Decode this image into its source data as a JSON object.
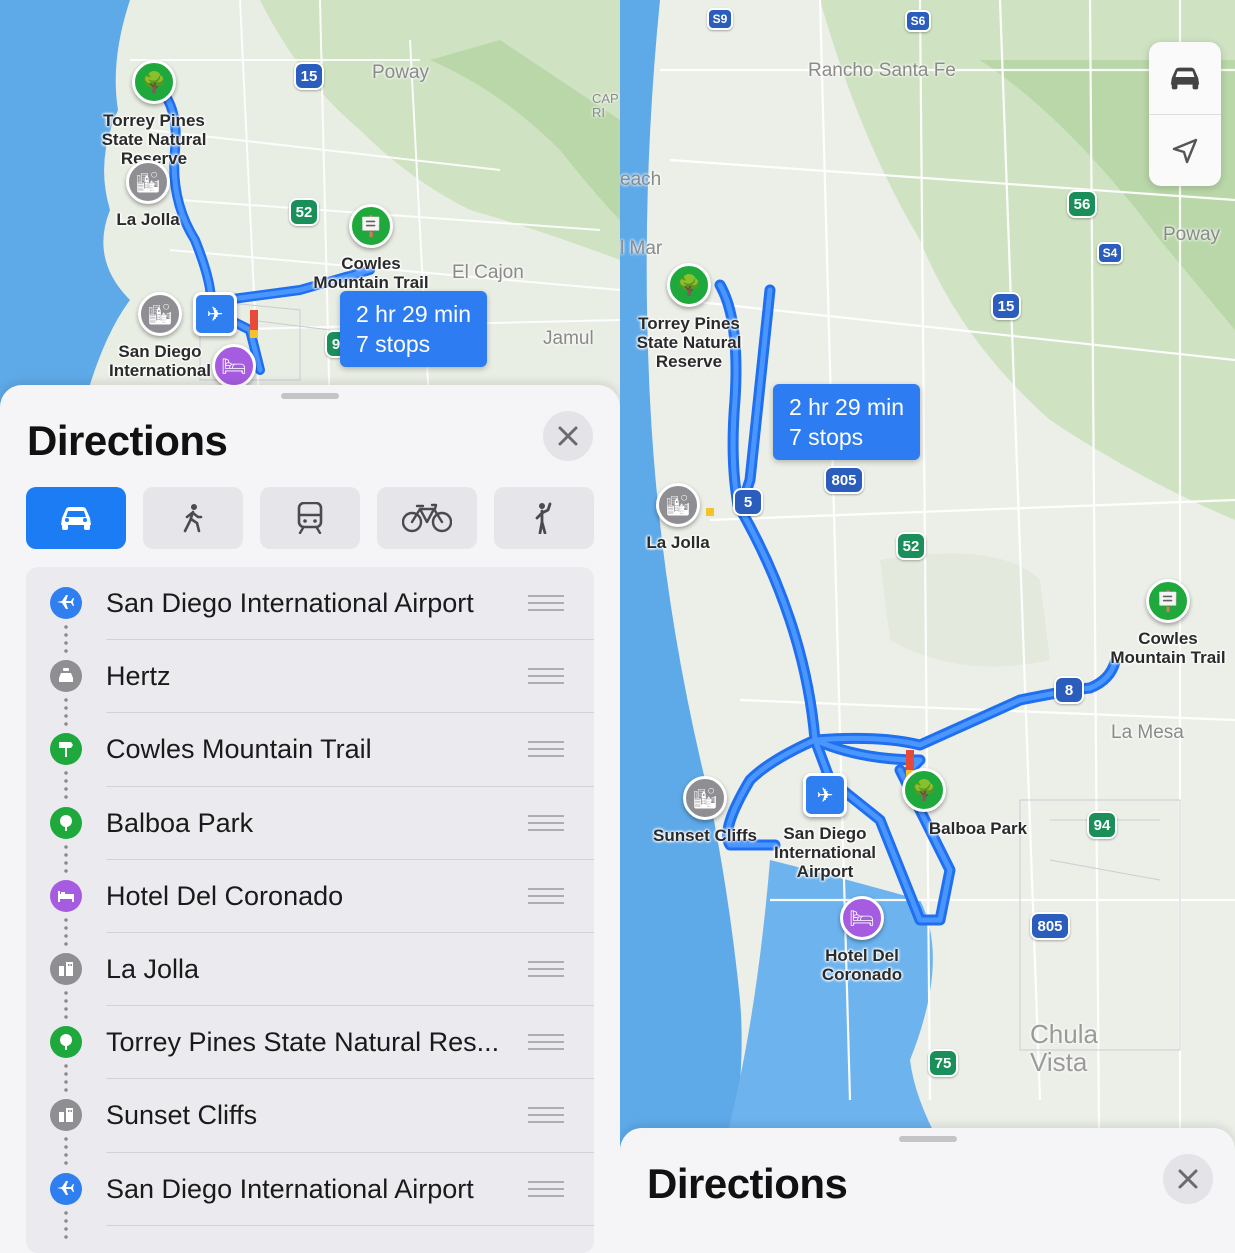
{
  "left_map": {
    "route_box": {
      "time": "2 hr 29 min",
      "stops": "7 stops"
    },
    "places": {
      "torrey_pines": "Torrey Pines\nState Natural\nReserve",
      "la_jolla": "La Jolla",
      "cowles": "Cowles\nMountain Trail",
      "san_diego_airport": "San Diego\nInternational"
    },
    "cities": {
      "poway": "Poway",
      "el_cajon": "El Cajon",
      "jamul": "Jamul",
      "cap": "CAP\nRI"
    },
    "highways": {
      "i15": "15",
      "r52": "52",
      "i9": "9"
    }
  },
  "directions_sheet": {
    "title": "Directions",
    "modes": [
      "drive",
      "walk",
      "transit",
      "cycle",
      "ride-share"
    ],
    "active_mode": "drive",
    "stops": [
      {
        "label": "San Diego International Airport",
        "icon": "airplane-icon",
        "color": "blue"
      },
      {
        "label": "Hertz",
        "icon": "car-rental-icon",
        "color": "gray"
      },
      {
        "label": "Cowles Mountain Trail",
        "icon": "trail-sign-icon",
        "color": "green"
      },
      {
        "label": "Balboa Park",
        "icon": "tree-icon",
        "color": "green"
      },
      {
        "label": "Hotel Del Coronado",
        "icon": "bed-icon",
        "color": "purple"
      },
      {
        "label": "La Jolla",
        "icon": "city-icon",
        "color": "gray"
      },
      {
        "label": "Torrey Pines State Natural Res...",
        "icon": "tree-icon",
        "color": "green"
      },
      {
        "label": "Sunset Cliffs",
        "icon": "city-icon",
        "color": "gray"
      },
      {
        "label": "San Diego International Airport",
        "icon": "airplane-icon",
        "color": "blue"
      }
    ]
  },
  "right_map": {
    "route_box": {
      "time": "2 hr 29 min",
      "stops": "7 stops"
    },
    "places": {
      "torrey_pines": "Torrey Pines\nState Natural\nReserve",
      "la_jolla": "La Jolla",
      "cowles": "Cowles\nMountain Trail",
      "sunset_cliffs": "Sunset Cliffs",
      "san_diego_airport": "San Diego\nInternational\nAirport",
      "balboa_park": "Balboa Park",
      "hotel_del": "Hotel Del\nCoronado"
    },
    "cities": {
      "rancho_santa_fe": "Rancho Santa Fe",
      "poway": "Poway",
      "la_mesa": "La Mesa",
      "chula_vista": "Chula\nVista",
      "beach": "each",
      "del_mar": "l Mar"
    },
    "highways": {
      "s9": "S9",
      "s6": "S6",
      "r56": "56",
      "s4": "S4",
      "i15": "15",
      "i805a": "805",
      "i5": "5",
      "r52": "52",
      "i8": "8",
      "r94": "94",
      "i805b": "805",
      "r75": "75"
    }
  },
  "bottom_sheet": {
    "title": "Directions"
  },
  "colors": {
    "route": "#2d7cf2",
    "accent": "#1c7cf4",
    "park_green": "#1fa83c"
  }
}
